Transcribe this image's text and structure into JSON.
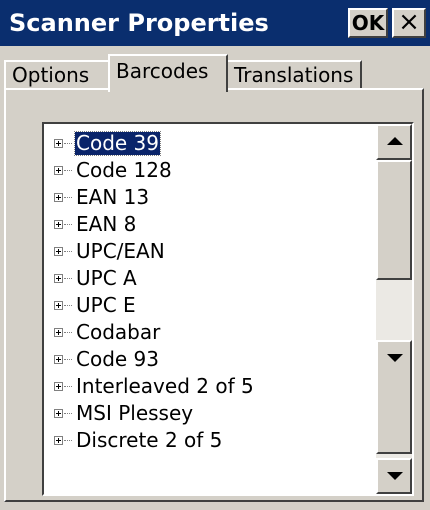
{
  "window": {
    "title": "Scanner Properties",
    "ok_label": "OK",
    "close_label": "×"
  },
  "tabs": [
    {
      "label": "Options",
      "selected": false
    },
    {
      "label": "Barcodes",
      "selected": true
    },
    {
      "label": "Translations",
      "selected": false
    }
  ],
  "tree": {
    "items": [
      {
        "label": "Code 39",
        "selected": true
      },
      {
        "label": "Code 128",
        "selected": false
      },
      {
        "label": "EAN 13",
        "selected": false
      },
      {
        "label": "EAN 8",
        "selected": false
      },
      {
        "label": "UPC/EAN",
        "selected": false
      },
      {
        "label": "UPC A",
        "selected": false
      },
      {
        "label": "UPC E",
        "selected": false
      },
      {
        "label": "Codabar",
        "selected": false
      },
      {
        "label": "Code 93",
        "selected": false
      },
      {
        "label": "Interleaved 2 of 5",
        "selected": false
      },
      {
        "label": "MSI Plessey",
        "selected": false
      },
      {
        "label": "Discrete 2 of 5",
        "selected": false
      }
    ]
  },
  "colors": {
    "titlebar": "#0a2e6e",
    "selection": "#0a246a",
    "face": "#d4d0c8"
  }
}
